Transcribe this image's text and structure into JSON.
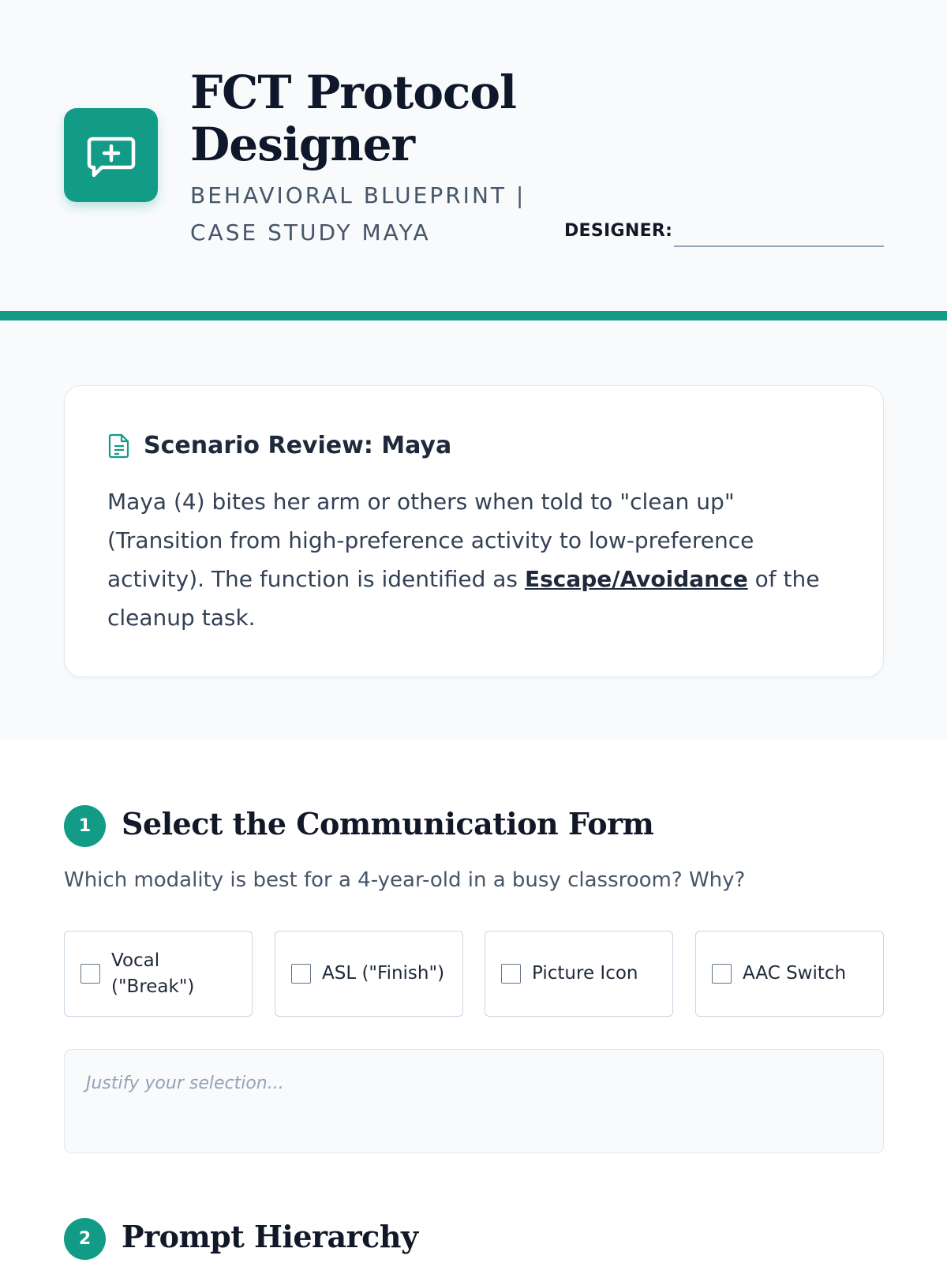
{
  "header": {
    "title": "FCT Protocol Designer",
    "subtitle": "BEHAVIORAL BLUEPRINT | CASE STUDY MAYA",
    "designer_label": "DESIGNER:",
    "designer_value": "",
    "logo_icon": "message-plus-icon",
    "accent_color": "#129b86"
  },
  "scenario": {
    "icon": "document-icon",
    "title": "Scenario Review: Maya",
    "text_before": "Maya (4) bites her arm or others when told to \"clean up\" (Transition from high-preference activity to low-preference activity). The function is identified as ",
    "highlight": "Escape/Avoidance",
    "text_after": " of the cleanup task."
  },
  "step1": {
    "number": "1",
    "title": "Select the Communication Form",
    "question": "Which modality is best for a 4-year-old in a busy classroom? Why?",
    "options": [
      {
        "label": "Vocal (\"Break\")",
        "checked": false
      },
      {
        "label": "ASL (\"Finish\")",
        "checked": false
      },
      {
        "label": "Picture Icon",
        "checked": false
      },
      {
        "label": "AAC Switch",
        "checked": false
      }
    ],
    "justify_placeholder": "Justify your selection...",
    "justify_value": ""
  },
  "step2": {
    "number": "2",
    "title": "Prompt Hierarchy"
  }
}
